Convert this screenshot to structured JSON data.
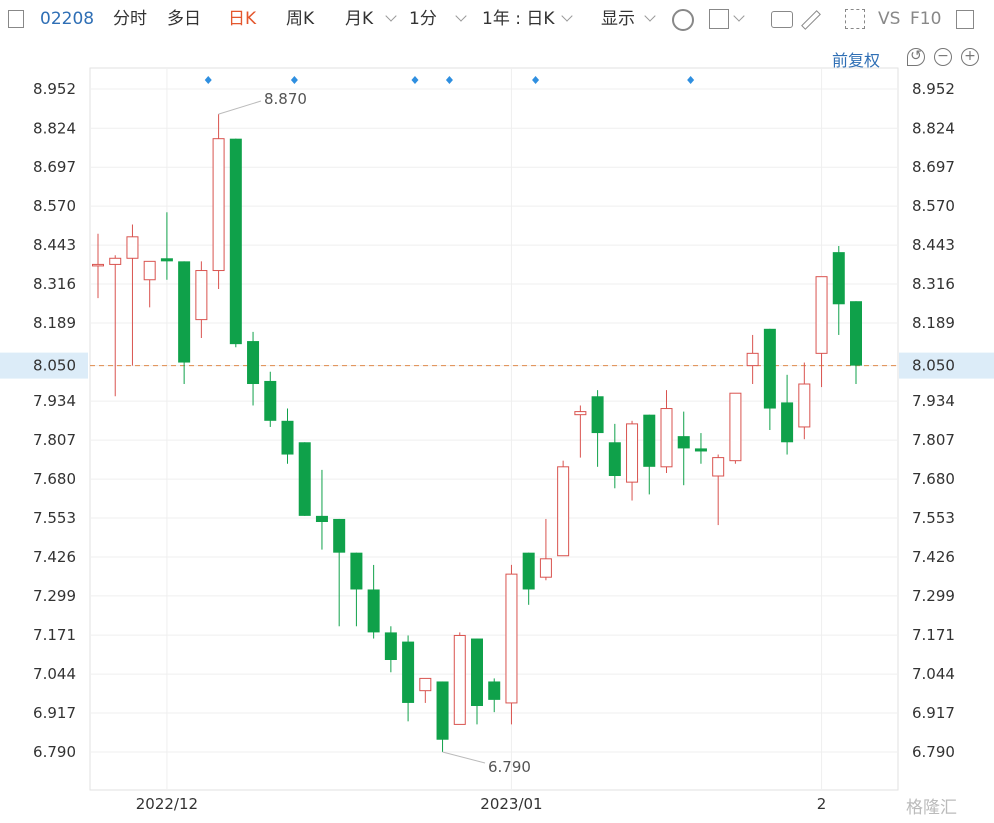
{
  "toolbar": {
    "code": "02208",
    "timeshare": "分时",
    "multi_day": "多日",
    "day_k": "日K",
    "week_k": "周K",
    "month_k": "月K",
    "minute": "1分",
    "range": "1年 : 日K",
    "display": "显示",
    "vs": "VS",
    "f10": "F10"
  },
  "adjust_label": "前复权",
  "watermark": "格隆汇",
  "colors": {
    "up": "#d9534f",
    "down": "#0fa14a",
    "current_line": "#e08a4b",
    "current_bg": "#dcecf8",
    "marker": "#2f8fe0"
  },
  "chart_data": {
    "type": "candlestick",
    "ylim": [
      6.72,
      9.02
    ],
    "yticks": [
      "8.952",
      "8.824",
      "8.697",
      "8.570",
      "8.443",
      "8.316",
      "8.189",
      "8.050",
      "7.934",
      "7.807",
      "7.680",
      "7.553",
      "7.426",
      "7.299",
      "7.171",
      "7.044",
      "6.917",
      "6.790"
    ],
    "current_price": "8.050",
    "x_labels": [
      "2022/12",
      "2023/01",
      "2"
    ],
    "x_label_index": [
      4,
      24,
      42
    ],
    "annotations": [
      {
        "label": "8.870",
        "index": 7,
        "value": 8.87
      },
      {
        "label": "6.790",
        "index": 20,
        "value": 6.79
      }
    ],
    "event_marker_index": [
      6,
      11,
      18,
      20,
      25,
      34
    ],
    "candles": [
      {
        "o": 8.38,
        "h": 8.48,
        "l": 8.27,
        "c": 8.38
      },
      {
        "o": 8.38,
        "h": 8.41,
        "l": 7.95,
        "c": 8.4
      },
      {
        "o": 8.4,
        "h": 8.51,
        "l": 8.05,
        "c": 8.47
      },
      {
        "o": 8.33,
        "h": 8.39,
        "l": 8.24,
        "c": 8.39
      },
      {
        "o": 8.4,
        "h": 8.55,
        "l": 8.33,
        "c": 8.39
      },
      {
        "o": 8.39,
        "h": 8.39,
        "l": 7.99,
        "c": 8.06
      },
      {
        "o": 8.2,
        "h": 8.39,
        "l": 8.14,
        "c": 8.36
      },
      {
        "o": 8.36,
        "h": 8.87,
        "l": 8.3,
        "c": 8.79
      },
      {
        "o": 8.79,
        "h": 8.79,
        "l": 8.11,
        "c": 8.12
      },
      {
        "o": 8.13,
        "h": 8.16,
        "l": 7.92,
        "c": 7.99
      },
      {
        "o": 8.0,
        "h": 8.03,
        "l": 7.85,
        "c": 7.87
      },
      {
        "o": 7.87,
        "h": 7.91,
        "l": 7.73,
        "c": 7.76
      },
      {
        "o": 7.8,
        "h": 7.8,
        "l": 7.56,
        "c": 7.56
      },
      {
        "o": 7.56,
        "h": 7.71,
        "l": 7.45,
        "c": 7.54
      },
      {
        "o": 7.55,
        "h": 7.55,
        "l": 7.2,
        "c": 7.44
      },
      {
        "o": 7.44,
        "h": 7.44,
        "l": 7.2,
        "c": 7.32
      },
      {
        "o": 7.32,
        "h": 7.4,
        "l": 7.16,
        "c": 7.18
      },
      {
        "o": 7.18,
        "h": 7.2,
        "l": 7.05,
        "c": 7.09
      },
      {
        "o": 7.15,
        "h": 7.17,
        "l": 6.89,
        "c": 6.95
      },
      {
        "o": 6.99,
        "h": 7.03,
        "l": 6.95,
        "c": 7.03
      },
      {
        "o": 7.02,
        "h": 7.02,
        "l": 6.79,
        "c": 6.83
      },
      {
        "o": 6.88,
        "h": 7.18,
        "l": 6.88,
        "c": 7.17
      },
      {
        "o": 7.16,
        "h": 7.16,
        "l": 6.88,
        "c": 6.94
      },
      {
        "o": 7.02,
        "h": 7.03,
        "l": 6.92,
        "c": 6.96
      },
      {
        "o": 6.95,
        "h": 7.4,
        "l": 6.88,
        "c": 7.37
      },
      {
        "o": 7.44,
        "h": 7.44,
        "l": 7.27,
        "c": 7.32
      },
      {
        "o": 7.36,
        "h": 7.55,
        "l": 7.35,
        "c": 7.42
      },
      {
        "o": 7.43,
        "h": 7.74,
        "l": 7.43,
        "c": 7.72
      },
      {
        "o": 7.89,
        "h": 7.92,
        "l": 7.75,
        "c": 7.9
      },
      {
        "o": 7.95,
        "h": 7.97,
        "l": 7.72,
        "c": 7.83
      },
      {
        "o": 7.8,
        "h": 7.86,
        "l": 7.65,
        "c": 7.69
      },
      {
        "o": 7.67,
        "h": 7.87,
        "l": 7.61,
        "c": 7.86
      },
      {
        "o": 7.89,
        "h": 7.89,
        "l": 7.63,
        "c": 7.72
      },
      {
        "o": 7.72,
        "h": 7.97,
        "l": 7.7,
        "c": 7.91
      },
      {
        "o": 7.82,
        "h": 7.9,
        "l": 7.66,
        "c": 7.78
      },
      {
        "o": 7.78,
        "h": 7.83,
        "l": 7.73,
        "c": 7.77
      },
      {
        "o": 7.69,
        "h": 7.76,
        "l": 7.53,
        "c": 7.75
      },
      {
        "o": 7.74,
        "h": 7.96,
        "l": 7.73,
        "c": 7.96
      },
      {
        "o": 8.05,
        "h": 8.15,
        "l": 7.99,
        "c": 8.09
      },
      {
        "o": 8.17,
        "h": 8.17,
        "l": 7.84,
        "c": 7.91
      },
      {
        "o": 7.93,
        "h": 8.02,
        "l": 7.76,
        "c": 7.8
      },
      {
        "o": 7.85,
        "h": 8.06,
        "l": 7.81,
        "c": 7.99
      },
      {
        "o": 8.09,
        "h": 8.34,
        "l": 7.98,
        "c": 8.34
      },
      {
        "o": 8.42,
        "h": 8.44,
        "l": 8.15,
        "c": 8.25
      },
      {
        "o": 8.26,
        "h": 8.26,
        "l": 7.99,
        "c": 8.05
      }
    ]
  }
}
